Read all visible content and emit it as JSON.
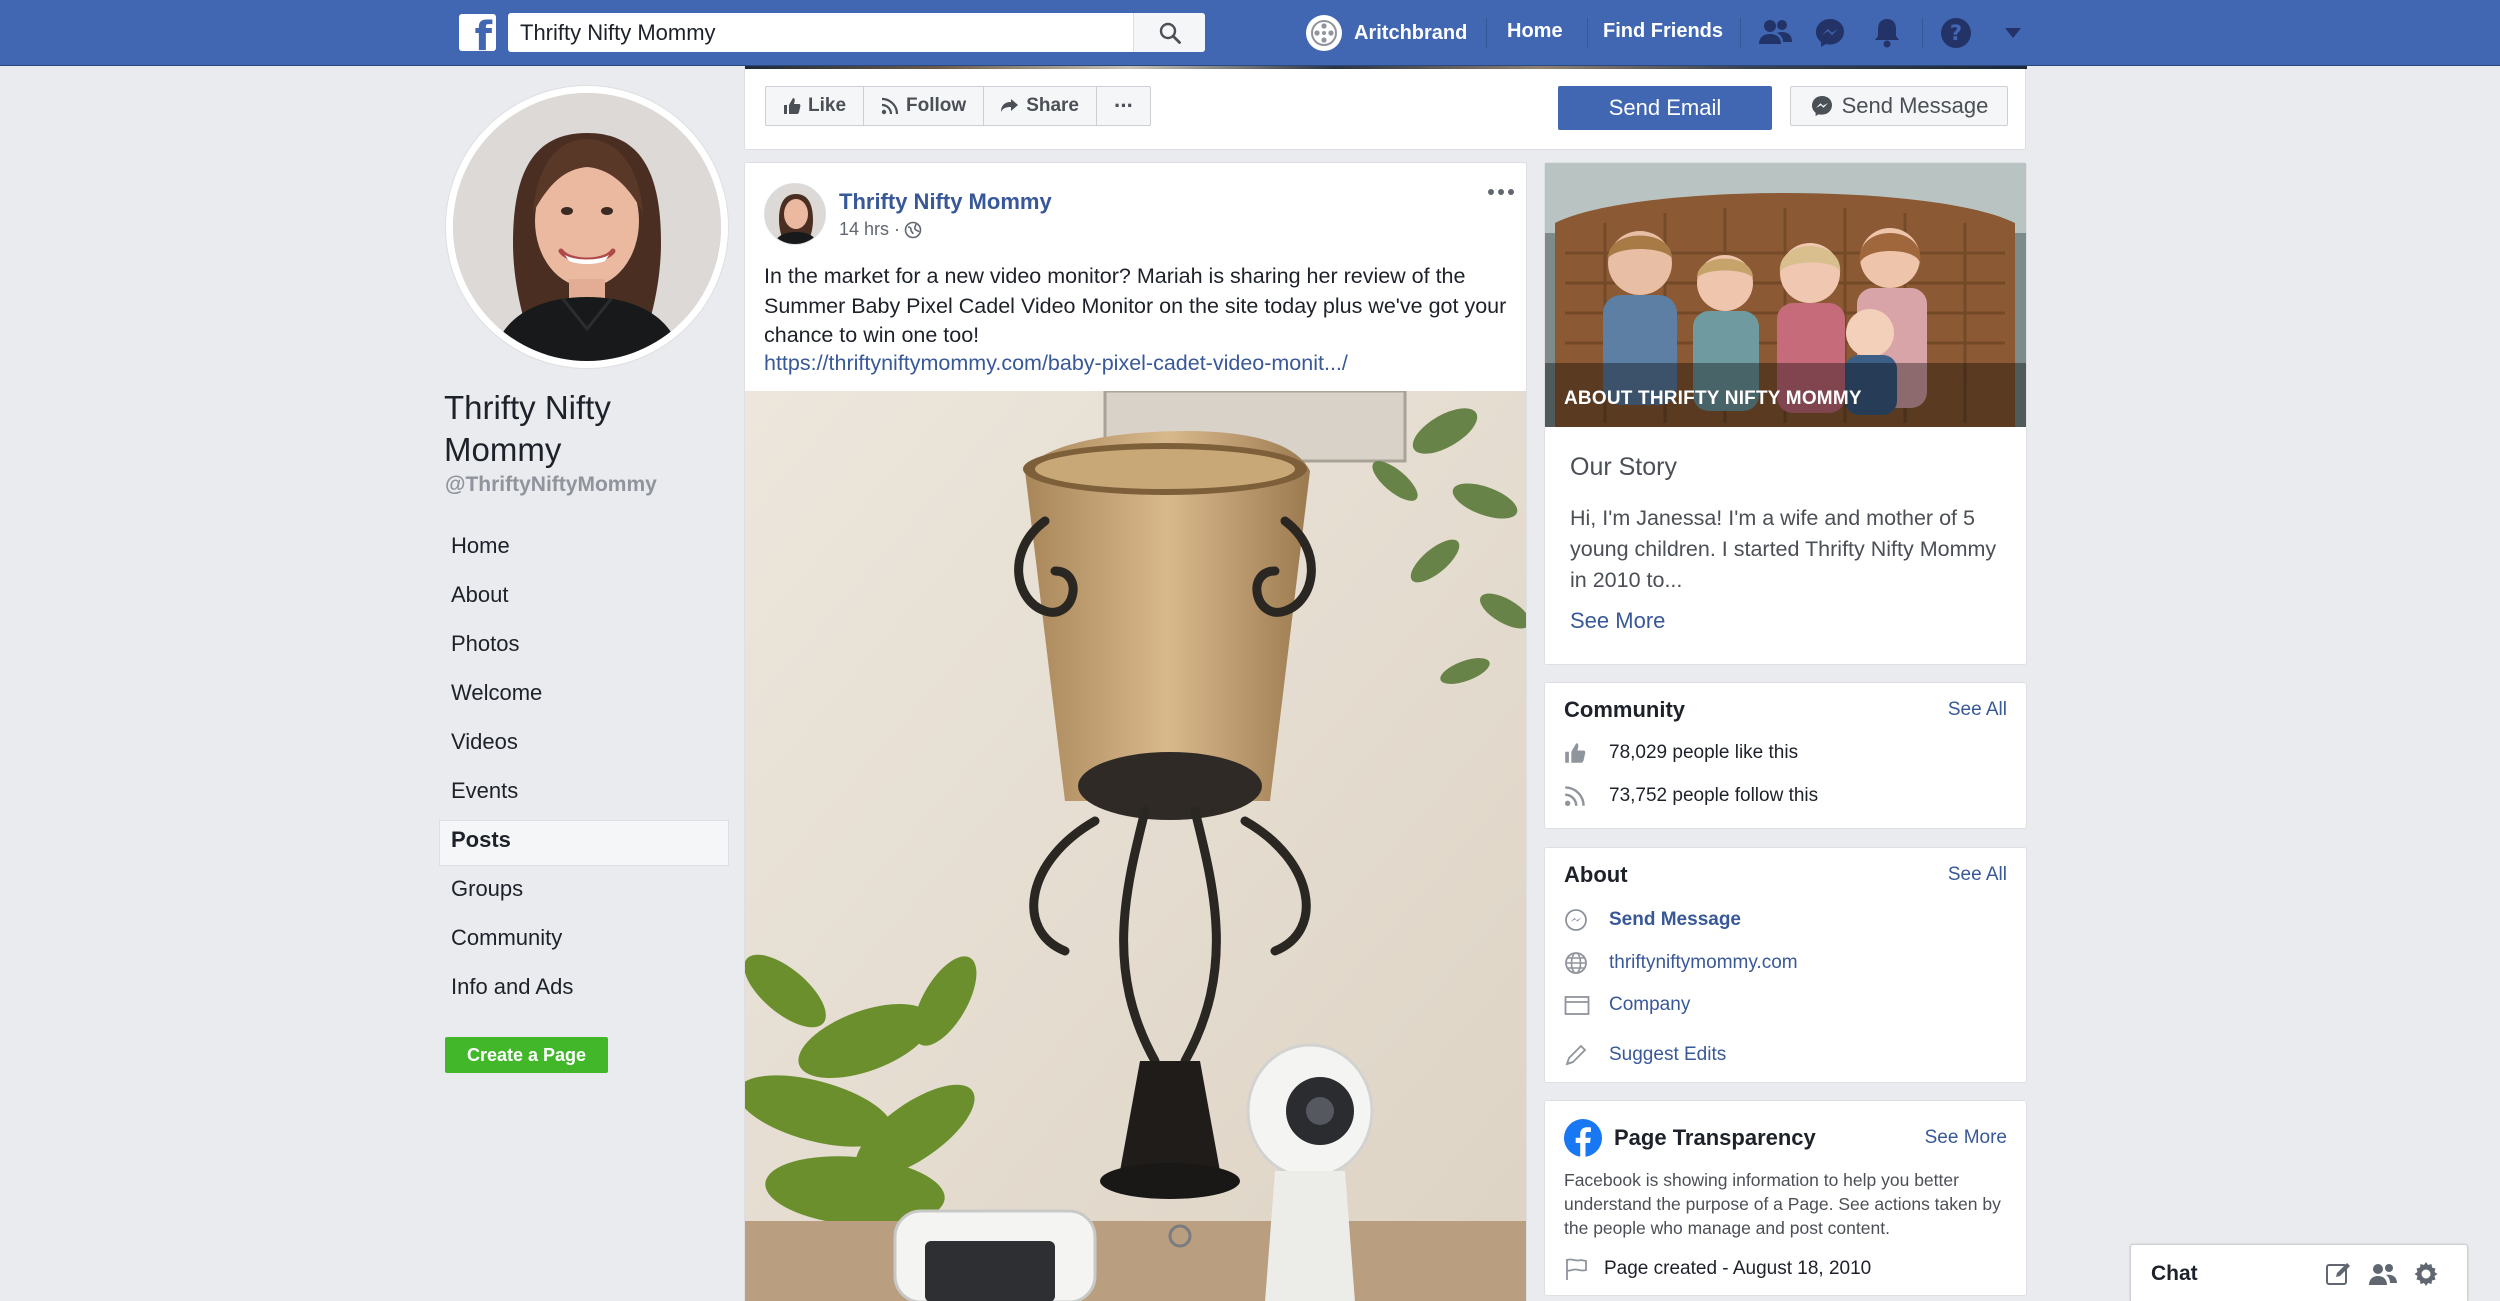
{
  "topbar": {
    "search_value": "Thrifty Nifty Mommy",
    "profile_name": "Aritchbrand",
    "home_label": "Home",
    "find_friends_label": "Find Friends"
  },
  "page": {
    "name": "Thrifty Nifty Mommy",
    "handle": "@ThriftyNiftyMommy"
  },
  "sidebar": {
    "items": [
      {
        "label": "Home"
      },
      {
        "label": "About"
      },
      {
        "label": "Photos"
      },
      {
        "label": "Welcome"
      },
      {
        "label": "Videos"
      },
      {
        "label": "Events"
      },
      {
        "label": "Posts"
      },
      {
        "label": "Groups"
      },
      {
        "label": "Community"
      },
      {
        "label": "Info and Ads"
      }
    ],
    "active": "Posts",
    "create_page_label": "Create a Page"
  },
  "actions": {
    "like": "Like",
    "follow": "Follow",
    "share": "Share",
    "more": "···",
    "send_email": "Send Email",
    "send_message": "Send Message"
  },
  "post": {
    "author": "Thrifty Nifty Mommy",
    "time": "14 hrs ·",
    "text": "In the market for a new video monitor? Mariah is sharing her review of the Summer Baby Pixel Cadel Video Monitor on the site today plus we've got your chance to win one too!",
    "link": "https://thriftyniftymommy.com/baby-pixel-cadet-video-monit.../"
  },
  "about_card": {
    "photo_label": "ABOUT THRIFTY NIFTY MOMMY",
    "story_title": "Our Story",
    "story_text": "Hi, I'm Janessa! I'm a wife and mother of 5 young children. I started Thrifty Nifty Mommy in 2010 to...",
    "see_more": "See More"
  },
  "community": {
    "title": "Community",
    "see_all": "See All",
    "likes": "78,029 people like this",
    "follows": "73,752 people follow this"
  },
  "about_info": {
    "title": "About",
    "see_all": "See All",
    "send_message": "Send Message",
    "website": "thriftyniftymommy.com",
    "category": "Company",
    "suggest_edits": "Suggest Edits"
  },
  "transparency": {
    "title": "Page Transparency",
    "see_more": "See More",
    "text": "Facebook is showing information to help you better understand the purpose of a Page. See actions taken by the people who manage and post content.",
    "created": "Page created - August 18, 2010"
  },
  "chat": {
    "label": "Chat"
  },
  "colors": {
    "brand_blue": "#4267b2",
    "link_blue": "#385898",
    "create_green": "#42b72a",
    "background": "#e9ebee"
  }
}
